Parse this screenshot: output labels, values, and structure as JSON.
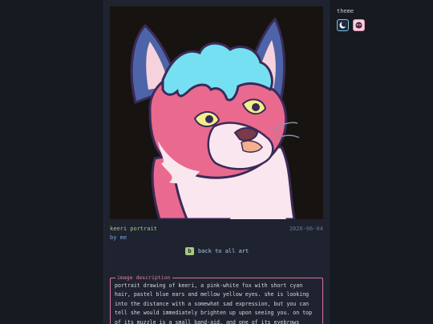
{
  "artwork": {
    "title": "keeri portrait",
    "date": "2026-06-04",
    "author": "by me",
    "image_alt": "portrait drawing of keeri"
  },
  "navigation": {
    "back_key": "b",
    "back_label": "back to all art"
  },
  "description": {
    "legend": "image description",
    "text": "portrait drawing of keeri, a pink-white fox with short cyan hair, pastel blue ears and mellow yellow eyes. she is looking into the distance with a somewhat sad expression, but you can tell she would immediately brighten up upon seeing you. on top of its muzzle is a small band-aid, and one of its eyebrows"
  },
  "theme": {
    "label": "theme",
    "options": [
      {
        "name": "dark",
        "icon": "moon-icon",
        "active": true
      },
      {
        "name": "light",
        "icon": "blob-icon",
        "active": false
      }
    ]
  },
  "colors": {
    "background": "#171a21",
    "panel": "#1f2330",
    "title_green": "#a8c87a",
    "link_blue": "#7aa6d8",
    "accent_pink": "#d8729e"
  }
}
